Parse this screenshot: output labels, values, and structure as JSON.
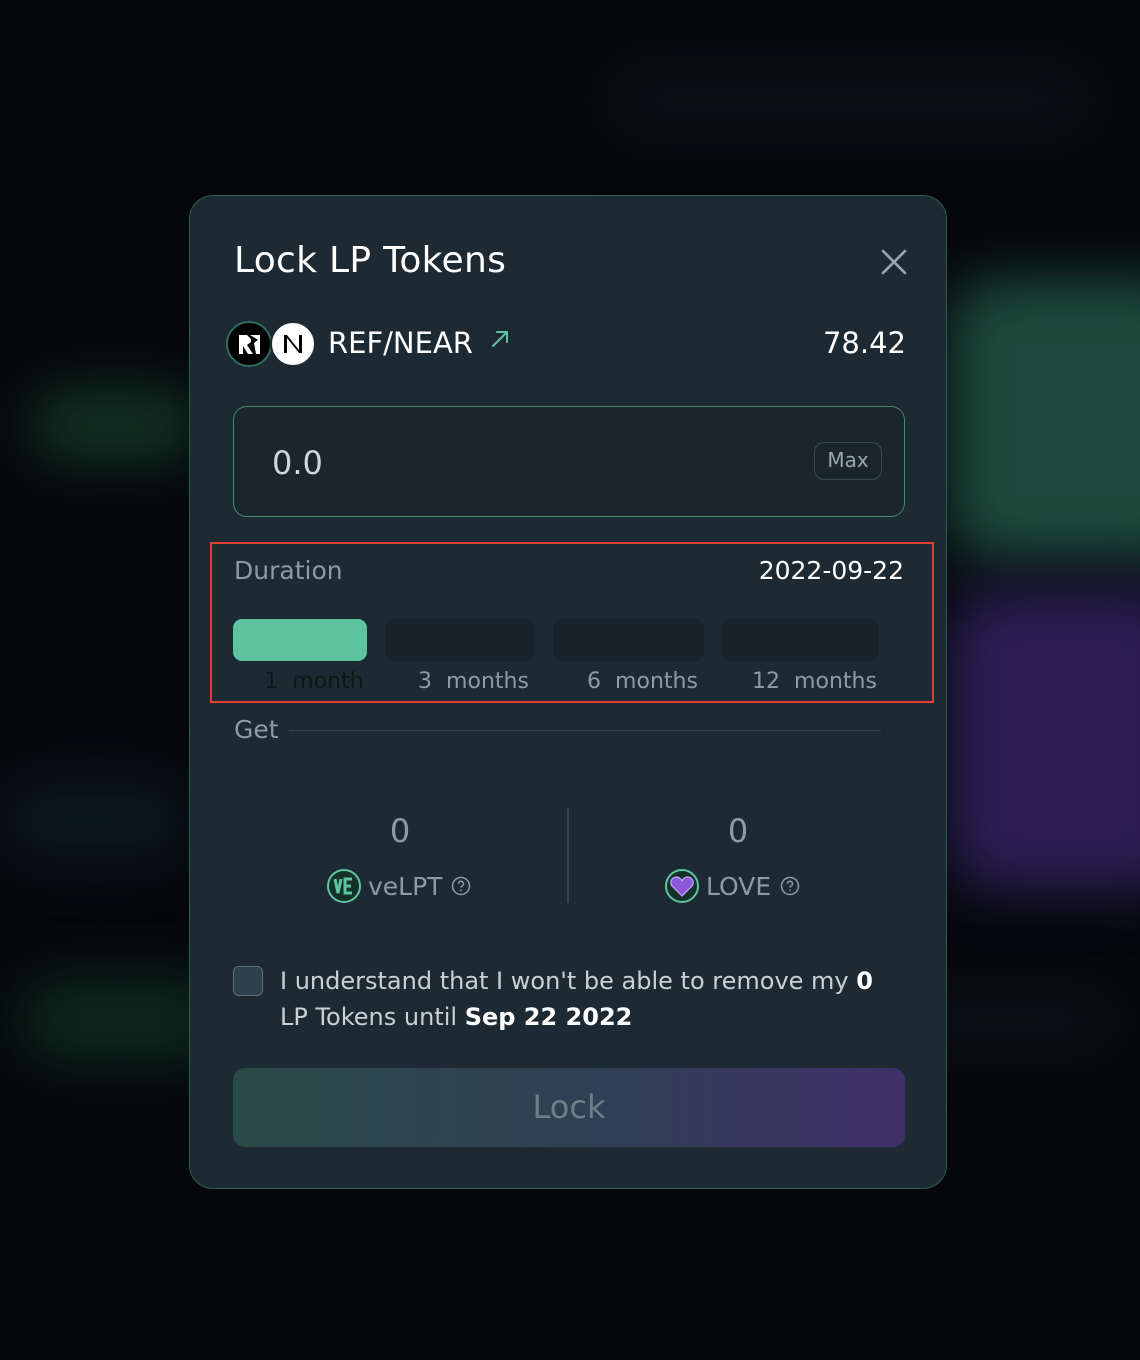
{
  "modal": {
    "title": "Lock LP Tokens"
  },
  "pair": {
    "name": "REF/NEAR",
    "balance": "78.42",
    "token_icons": [
      "ref-token-icon",
      "near-token-icon"
    ]
  },
  "amount": {
    "value": "",
    "placeholder": "0.0",
    "max_label": "Max"
  },
  "duration": {
    "label": "Duration",
    "unlock_date": "2022-09-22",
    "selected": "1 month",
    "options": [
      {
        "count": "1",
        "unit": "month"
      },
      {
        "count": "3",
        "unit": "months"
      },
      {
        "count": "6",
        "unit": "months"
      },
      {
        "count": "12",
        "unit": "months"
      }
    ]
  },
  "get": {
    "label": "Get",
    "rewards": [
      {
        "value": "0",
        "symbol": "veLPT",
        "icon": "ve-token-icon"
      },
      {
        "value": "0",
        "symbol": "LOVE",
        "icon": "love-heart-icon"
      }
    ]
  },
  "confirm": {
    "checked": false,
    "text_before": "I understand that I won't be able to remove my",
    "amount": "0",
    "text_middle": "LP Tokens until",
    "date": "Sep 22 2022"
  },
  "lock_button": {
    "label": "Lock"
  },
  "colors": {
    "accent_green": "#5ec4a0",
    "highlight_red": "#e0412f",
    "modal_bg": "#1d2a33",
    "lock_gradient": [
      "#2a4a48",
      "#40306a"
    ]
  }
}
